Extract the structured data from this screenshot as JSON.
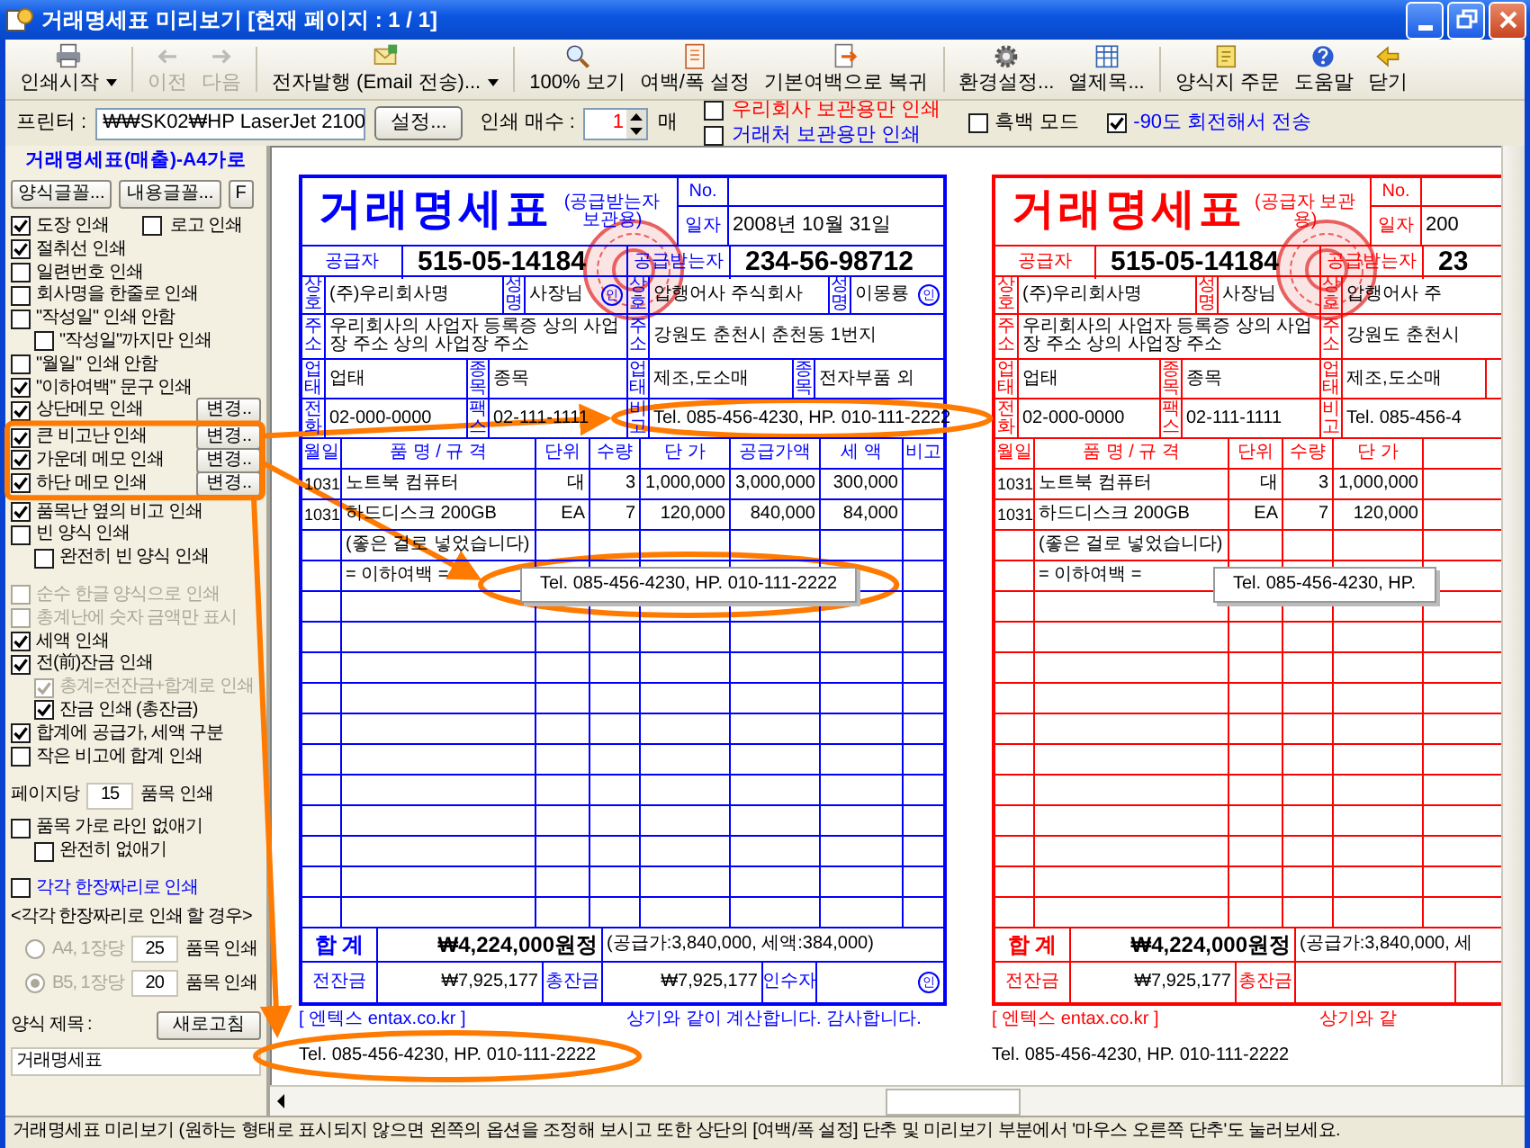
{
  "window": {
    "title": "거래명세표 미리보기 [현재 페이지 : 1 / 1]"
  },
  "toolbar": {
    "groups": [
      [
        {
          "label": "인쇄시작",
          "dropdown": true,
          "disabled": false
        }
      ],
      [
        {
          "label": "이전",
          "dropdown": false,
          "disabled": true
        },
        {
          "label": "다음",
          "dropdown": false,
          "disabled": true
        }
      ],
      [
        {
          "label": "전자발행 (Email 전송)...",
          "dropdown": true,
          "disabled": false
        }
      ],
      [
        {
          "label": "100% 보기",
          "dropdown": false,
          "disabled": false
        },
        {
          "label": "여백/폭 설정",
          "dropdown": false,
          "disabled": false
        },
        {
          "label": "기본여백으로 복귀",
          "dropdown": false,
          "disabled": false
        }
      ],
      [
        {
          "label": "환경설정...",
          "dropdown": false,
          "disabled": false
        },
        {
          "label": "열제목...",
          "dropdown": false,
          "disabled": false
        }
      ],
      [
        {
          "label": "양식지 주문",
          "dropdown": false,
          "disabled": false
        },
        {
          "label": "도움말",
          "dropdown": false,
          "disabled": false
        },
        {
          "label": "닫기",
          "dropdown": false,
          "disabled": false
        }
      ]
    ]
  },
  "print_bar": {
    "printer_label": "프린터 :",
    "printer": "₩₩SK02₩HP LaserJet 2100",
    "setup_button": "설정...",
    "copies_label": "인쇄 매수 :",
    "copies": "1",
    "copies_unit": "매",
    "options": [
      [
        {
          "label": "우리회사 보관용만 인쇄",
          "checked": false,
          "color": "#ff0000"
        },
        {
          "label": "거래처 보관용만 인쇄",
          "checked": false,
          "color": "#0000ff"
        }
      ],
      [
        {
          "label": "흑백 모드",
          "checked": false,
          "color": "#000000"
        }
      ],
      [
        {
          "label": "-90도 회전해서 전송",
          "checked": true,
          "color": "#0000ff"
        }
      ]
    ]
  },
  "sidebar": {
    "title": "거래명세표(매출)-A4가로",
    "font_buttons": [
      "양식글꼴...",
      "내용글꼴...",
      "F"
    ],
    "option_groups": [
      [
        {
          "label": "도장 인쇄",
          "checked": true,
          "disabled": false,
          "beside": {
            "label": "로고 인쇄",
            "checked": false,
            "disabled": false
          }
        },
        {
          "label": "절취선 인쇄",
          "checked": true,
          "disabled": false
        },
        {
          "label": "일련번호 인쇄",
          "checked": false,
          "disabled": false
        },
        {
          "label": "회사명을 한줄로 인쇄",
          "checked": false,
          "disabled": false
        },
        {
          "label": "\"작성일\" 인쇄 안함",
          "checked": false,
          "disabled": false,
          "children": [
            {
              "label": "\"작성일\"까지만 인쇄",
              "checked": false,
              "disabled": false
            }
          ]
        },
        {
          "label": "\"월일\" 인쇄 안함",
          "checked": false,
          "disabled": false
        },
        {
          "label": "\"이하여백\" 문구 인쇄",
          "checked": true,
          "disabled": false
        },
        {
          "label": "상단메모 인쇄",
          "checked": true,
          "disabled": false,
          "button": "변경.."
        },
        {
          "label": "큰 비고난 인쇄",
          "checked": true,
          "disabled": false,
          "button": "변경.."
        },
        {
          "label": "가운데 메모 인쇄",
          "checked": true,
          "disabled": false,
          "button": "변경.."
        },
        {
          "label": "하단 메모 인쇄",
          "checked": true,
          "disabled": false,
          "button": "변경.."
        },
        {
          "label": "품목난 옆의 비고 인쇄",
          "checked": true,
          "disabled": false
        },
        {
          "label": "빈 양식 인쇄",
          "checked": false,
          "disabled": false,
          "children": [
            {
              "label": "완전히 빈 양식 인쇄",
              "checked": false,
              "disabled": false
            }
          ]
        }
      ],
      [
        {
          "label": "순수 한글 양식으로 인쇄",
          "checked": false,
          "disabled": true
        },
        {
          "label": "총계난에 숫자 금액만 표시",
          "checked": false,
          "disabled": true
        },
        {
          "label": "세액 인쇄",
          "checked": true,
          "disabled": false
        },
        {
          "label": "전(前)잔금 인쇄",
          "checked": true,
          "disabled": false,
          "children": [
            {
              "label": "총계=전잔금+합계로 인쇄",
              "checked": true,
              "disabled": true
            },
            {
              "label": "잔금 인쇄 (총잔금)",
              "checked": true,
              "disabled": false
            }
          ]
        },
        {
          "label": "합계에 공급가, 세액 구분",
          "checked": true,
          "disabled": false
        },
        {
          "label": "작은 비고에 합계 인쇄",
          "checked": false,
          "disabled": false
        }
      ]
    ],
    "per_page": {
      "label": "페이지당",
      "value": "15",
      "unit": "품목 인쇄"
    },
    "line_options": [
      {
        "label": "품목 가로 라인 없애기",
        "checked": false,
        "disabled": false,
        "children": [
          {
            "label": "완전히 없애기",
            "checked": false,
            "disabled": false
          }
        ]
      }
    ],
    "single_sheet": {
      "label": "각각 한장짜리로 인쇄",
      "checked": false,
      "caption": "<각각 한장짜리로 인쇄 할 경우>",
      "choices": [
        {
          "label": "A4, 1장당",
          "value": "25",
          "unit": "품목 인쇄",
          "selected": false,
          "disabled": true
        },
        {
          "label": "B5, 1장당",
          "value": "20",
          "unit": "품목 인쇄",
          "selected": true,
          "disabled": true
        }
      ]
    },
    "form_title": {
      "label": "양식 제목 :",
      "button": "새로고침",
      "value": "거래명세표"
    }
  },
  "preview": {
    "copies": [
      {
        "color": "#0000ff",
        "title": "거래명세표",
        "copy_note": "(공급받는자 보관용)",
        "no_label": "No.",
        "date_label": "일자",
        "date": "2008년 10월 31일",
        "supplier": {
          "label": "공급자",
          "reg_no": "515-05-14184",
          "name_label": "상호",
          "name": "(주)우리회사명",
          "rep_label": "성명",
          "rep": "사장님",
          "seal": "인",
          "address_label": "주소",
          "address": "우리회사의 사업자 등록증 상의 사업장 주소 상의 사업장 주소",
          "biz_type_label": "업태",
          "biz_type": "업태",
          "biz_item_label": "종목",
          "biz_item": "종목",
          "phone_label": "전화",
          "phone": "02-000-0000",
          "fax_label": "팩스",
          "fax": "02-111-1111"
        },
        "buyer": {
          "label": "공급받는자",
          "reg_no": "234-56-98712",
          "name_label": "상호",
          "name": "압행어사 주식회사",
          "rep_label": "성명",
          "rep": "이몽룡",
          "seal": "인",
          "address_label": "주소",
          "address": "강원도 춘천시 춘천동 1번지",
          "biz_type_label": "업태",
          "biz_type": "제조,도소매",
          "biz_item_label": "종목",
          "biz_item": "전자부품 외",
          "memo_label": "비고",
          "memo": "Tel. 085-456-4230, HP. 010-111-2222"
        },
        "columns": [
          "월일",
          "품 명 / 규 격",
          "단위",
          "수량",
          "단 가",
          "공급가액",
          "세 액",
          "비고"
        ],
        "rows": [
          {
            "kind": "item",
            "cells": [
              "1031",
              "노트북 컴퓨터",
              "대",
              "3",
              "1,000,000",
              "3,000,000",
              "300,000"
            ]
          },
          {
            "kind": "item",
            "cells": [
              "1031",
              "하드디스크 200GB",
              "EA",
              "7",
              "120,000",
              "840,000",
              "84,000"
            ]
          },
          {
            "kind": "note",
            "text": "(좋은 걸로 넣었습니다)"
          },
          {
            "kind": "note",
            "text": "= 이하여백 ="
          }
        ],
        "middle_memo": "Tel. 085-456-4230, HP. 010-111-2222",
        "total_label": "합 계",
        "total": "₩4,224,000원정",
        "total_detail": "(공급가:3,840,000, 세액:384,000)",
        "prev_balance_label": "전잔금",
        "prev_balance": "₩7,925,177",
        "balance_label": "총잔금",
        "balance": "₩7,925,177",
        "receiver_label": "인수자",
        "receiver_seal": "인",
        "footer_left": "[ 엔텍스 entax.co.kr ]",
        "footer_right": "상기와 같이 계산합니다. 감사합니다.",
        "bottom_memo": "Tel. 085-456-4230, HP. 010-111-2222"
      },
      {
        "color": "#ff0000",
        "title": "거래명세표",
        "copy_note": "(공급자 보관용)",
        "no_label": "No.",
        "date_label": "일자",
        "date": "200",
        "supplier": {
          "label": "공급자",
          "reg_no": "515-05-14184",
          "name_label": "상호",
          "name": "(주)우리회사명",
          "rep_label": "성명",
          "rep": "사장님",
          "address_label": "주소",
          "address": "우리회사의 사업자 등록증 상의 사업장 주소 상의 사업장 주소",
          "biz_type_label": "업태",
          "biz_type": "업태",
          "biz_item_label": "종목",
          "biz_item": "종목",
          "phone_label": "전화",
          "phone": "02-000-0000",
          "fax_label": "팩스",
          "fax": "02-111-1111"
        },
        "buyer": {
          "label": "공급받는자",
          "reg_no": "23",
          "name_label": "상호",
          "name": "압행어사 주",
          "address_label": "주소",
          "address": "강원도 춘천시",
          "biz_type_label": "업태",
          "biz_type": "제조,도소매",
          "memo_label": "비고",
          "memo": "Tel. 085-456-4"
        },
        "columns": [
          "월일",
          "품 명 / 규 격",
          "단위",
          "수량",
          "단 가"
        ],
        "rows": [
          {
            "kind": "item",
            "cells": [
              "1031",
              "노트북 컴퓨터",
              "대",
              "3",
              "1,000,000"
            ]
          },
          {
            "kind": "item",
            "cells": [
              "1031",
              "하드디스크 200GB",
              "EA",
              "7",
              "120,000"
            ]
          },
          {
            "kind": "note",
            "text": "(좋은 걸로 넣었습니다)"
          },
          {
            "kind": "note",
            "text": "= 이하여백 ="
          }
        ],
        "middle_memo": "Tel. 085-456-4230, HP.",
        "total_label": "합 계",
        "total": "₩4,224,000원정",
        "total_detail": "(공급가:3,840,000, 세",
        "prev_balance_label": "전잔금",
        "prev_balance": "₩7,925,177",
        "balance_label": "총잔금",
        "footer_left": "[ 엔텍스 entax.co.kr ]",
        "footer_right": "상기와 같",
        "bottom_memo": "Tel. 085-456-4230, HP. 010-111-2222"
      }
    ]
  },
  "status_bar": {
    "text": "거래명세표 미리보기 (원하는 형태로 표시되지 않으면 왼쪽의 옵션을 조정해 보시고 또한 상단의 [여백/폭 설정] 단추 및 미리보기 부분에서 '마우스 오른쪽 단추'도 눌러보세요."
  }
}
